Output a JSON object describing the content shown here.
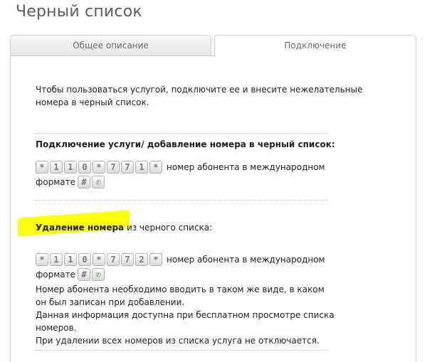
{
  "page": {
    "title": "Черный список"
  },
  "tabs": [
    {
      "label": "Общее описание"
    },
    {
      "label": "Подключение"
    }
  ],
  "content": {
    "intro_line1": "Чтобы пользоваться услугой, подключите ее и внесите нежелательные",
    "intro_line2": "номера в черный список.",
    "connect_heading": "Подключение услуги/ добавление номера в черный список:",
    "connect_keys": [
      "*",
      "1",
      "1",
      "0",
      "*",
      "7",
      "7",
      "1",
      "*"
    ],
    "connect_text": "номер абонента в международном",
    "format_label": "формате",
    "removal_heading_bold": "Удаление номера",
    "removal_heading_rest": " из черного списка:",
    "removal_keys": [
      "*",
      "1",
      "1",
      "0",
      "*",
      "7",
      "7",
      "2",
      "*"
    ],
    "removal_text": "номер абонента в международном",
    "note_line1": "Номер абонента необходимо вводить в таком же виде, в каком",
    "note_line2": "он был записан при добавлении.",
    "note_line3": "Данная информация доступна при бесплатном просмотре списка",
    "note_line4": "номеров.",
    "note_line5": "При удалении всех номеров из списка услуга не отключается."
  },
  "icons": {
    "hash": "#",
    "call": "call-icon",
    "call_color": "#3d8a2a",
    "highlight_color": "#ffff00"
  }
}
